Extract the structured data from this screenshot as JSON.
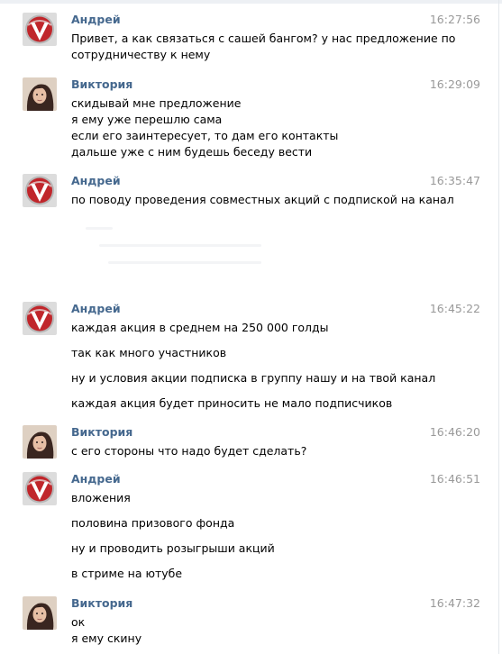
{
  "messages": [
    {
      "author": "Андрей",
      "time": "16:27:56",
      "avatar_icon": "andrey-logo-icon",
      "lines": [
        "Привет, а как связаться с сашей бангом? у нас предложение по",
        "сотрудничеству к нему"
      ]
    },
    {
      "author": "Виктория",
      "time": "16:29:09",
      "avatar_icon": "viktoria-photo-icon",
      "lines": [
        "скидывай мне предложение",
        "я ему уже перешлю сама",
        "если его заинтересует, то дам его контакты",
        "дальше уже с ним будешь беседу вести"
      ]
    },
    {
      "author": "Андрей",
      "time": "16:35:47",
      "avatar_icon": "andrey-logo-icon",
      "lines": [
        "по поводу проведения совместных акций с подпиской на канал"
      ]
    },
    {
      "author": "Андрей",
      "time": "16:45:22",
      "avatar_icon": "andrey-logo-icon",
      "lines": [
        "каждая акция в среднем на 250 000 голды",
        "так как много участников",
        "ну и условия акции подписка в группу нашу и на твой канал",
        "каждая акция будет приносить не мало подписчиков"
      ]
    },
    {
      "author": "Виктория",
      "time": "16:46:20",
      "avatar_icon": "viktoria-photo-icon",
      "lines": [
        "с его стороны что надо будет сделать?"
      ]
    },
    {
      "author": "Андрей",
      "time": "16:46:51",
      "avatar_icon": "andrey-logo-icon",
      "lines": [
        "вложения",
        "половина призового фонда",
        "ну и проводить розыгрыши акций",
        "в стриме на ютубе"
      ]
    },
    {
      "author": "Виктория",
      "time": "16:47:32",
      "avatar_icon": "viktoria-photo-icon",
      "lines": [
        "ок",
        "я ему скину"
      ]
    }
  ],
  "colors": {
    "author": "#45688e",
    "time": "#999999",
    "text": "#000000",
    "andrey_logo": "#c0262b"
  }
}
